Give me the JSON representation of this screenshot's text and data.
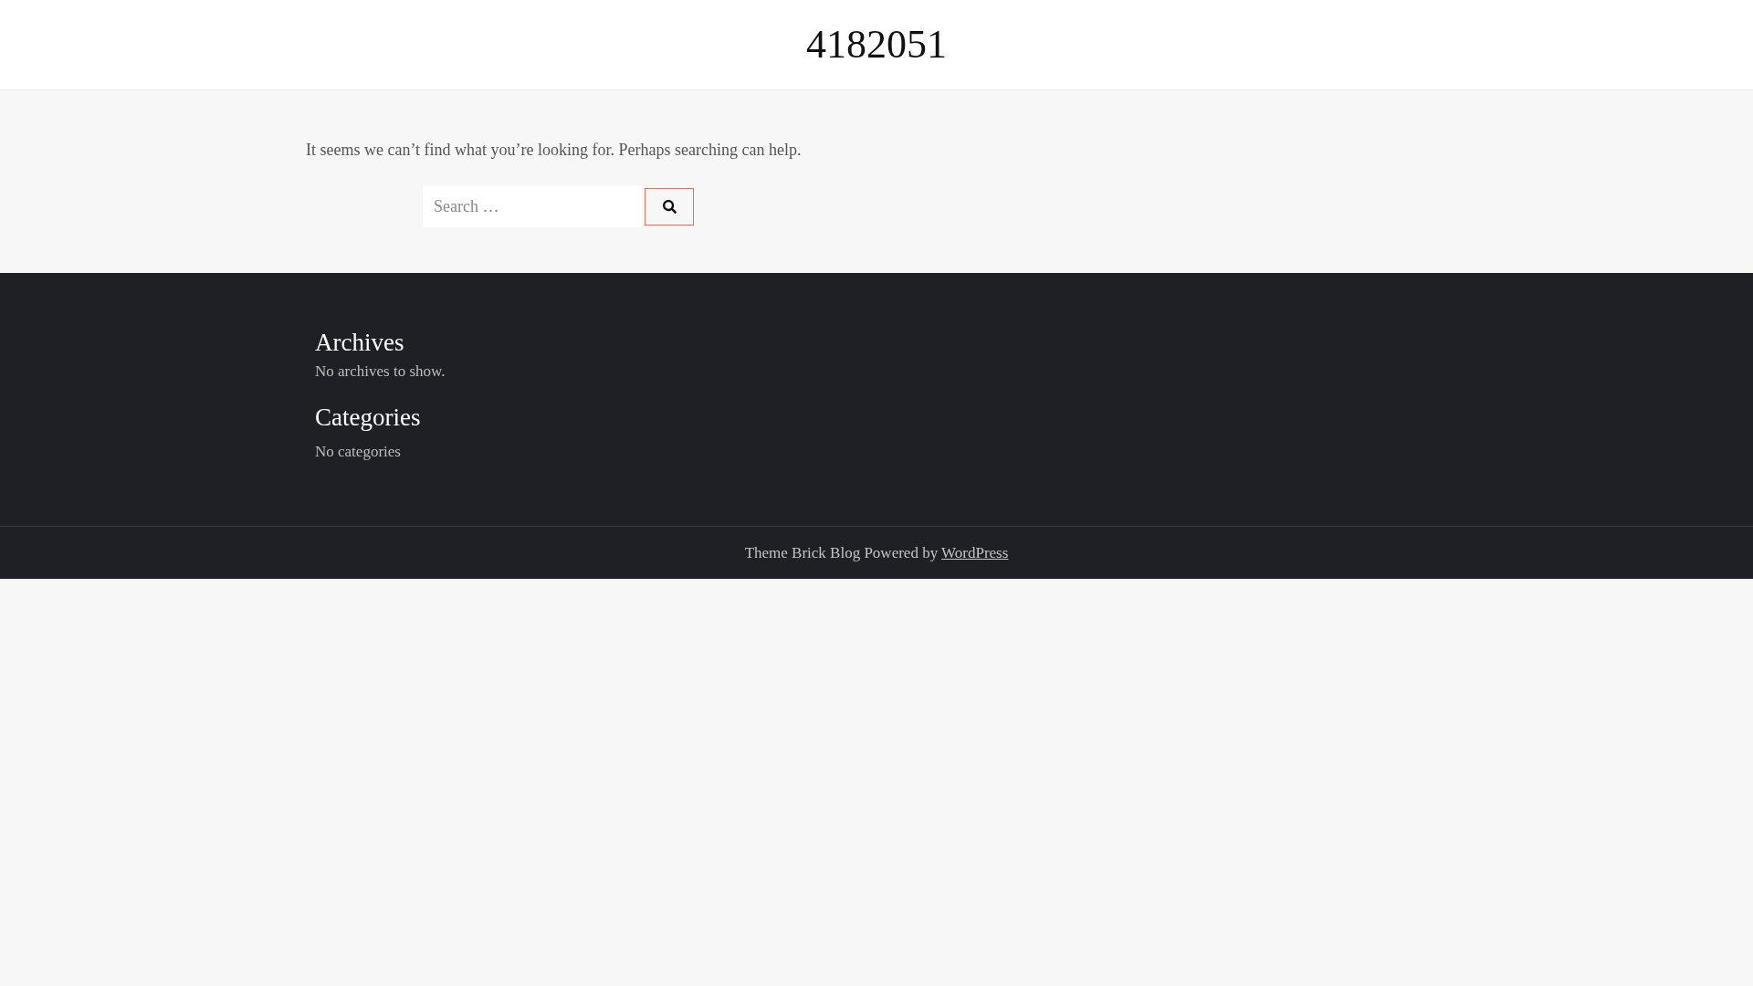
{
  "header": {
    "site_title": "4182051"
  },
  "not_found": {
    "message": "It seems we can’t find what you’re looking for. Perhaps searching can help.",
    "search": {
      "placeholder": "Search …"
    }
  },
  "widgets": [
    {
      "title": "Archives",
      "text": "No archives to show."
    },
    {
      "title": "Categories",
      "text": "No categories"
    }
  ],
  "footer": {
    "credit": "Theme Brick Blog Powered by",
    "link": "WordPress"
  }
}
